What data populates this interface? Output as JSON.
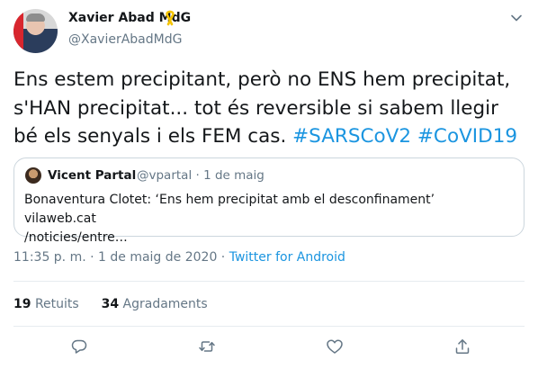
{
  "author": {
    "name": "Xavier Abad MdG",
    "handle": "@XavierAbadMdG"
  },
  "tweet": {
    "text_plain": "Ens estem precipitant, però no ENS hem precipitat, s'HAN precipitat... tot és reversible si sabem llegir bé els senyals i els FEM cas. ",
    "hashtag_1": "#SARSCoV2",
    "hashtag_2": "#CoVID19"
  },
  "quote": {
    "name": "Vicent Partal",
    "handle_date": "@vpartal · 1 de maig",
    "text_line_1": "Bonaventura Clotet: ‘Ens hem precipitat amb el desconfinament’ vilaweb.cat",
    "text_line_2": "/noticies/entre…"
  },
  "meta": {
    "timestamp": "11:35 p. m. · 1 de maig de 2020 · ",
    "source": "Twitter for Android"
  },
  "stats": {
    "retweets_count": "19",
    "retweets_label": "Retuits",
    "likes_count": "34",
    "likes_label": "Agradaments"
  },
  "colors": {
    "accent": "#1b95e0",
    "secondary_text": "#657786",
    "ribbon": "#f5c400"
  },
  "icons": [
    "yellow-ribbon-icon",
    "chevron-down-icon",
    "reply-icon",
    "retweet-icon",
    "like-icon",
    "share-icon"
  ]
}
